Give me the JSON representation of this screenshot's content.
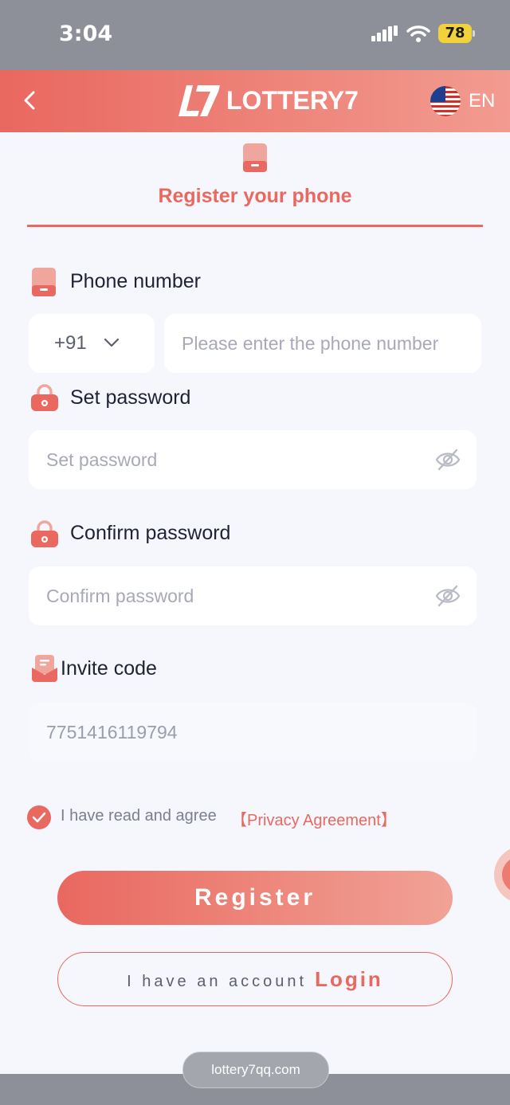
{
  "status": {
    "time": "3:04",
    "battery": "78"
  },
  "header": {
    "logo_text": "LOTTERY7",
    "lang": "EN"
  },
  "tab": {
    "title": "Register your phone"
  },
  "phone": {
    "label": "Phone number",
    "country_code": "+91",
    "placeholder": "Please enter the phone number"
  },
  "password": {
    "label": "Set password",
    "placeholder": "Set password"
  },
  "confirm": {
    "label": "Confirm password",
    "placeholder": "Confirm password"
  },
  "invite": {
    "label": "Invite code",
    "value": "7751416119794"
  },
  "agreement": {
    "text": "I have read and agree",
    "link": "【Privacy Agreement】"
  },
  "buttons": {
    "register": "Register",
    "have_account": "I have an account",
    "login": "Login"
  },
  "browser": {
    "url": "lottery7qq.com"
  },
  "colors": {
    "accent": "#e9685f",
    "accent_light": "#f29b90",
    "background": "#f6f7fc"
  },
  "icons": [
    "back-arrow-icon",
    "us-flag-icon",
    "phone-icon",
    "lock-icon",
    "eye-off-icon",
    "invite-icon",
    "check-icon",
    "chevron-down-icon",
    "signal-icon",
    "wifi-icon"
  ]
}
